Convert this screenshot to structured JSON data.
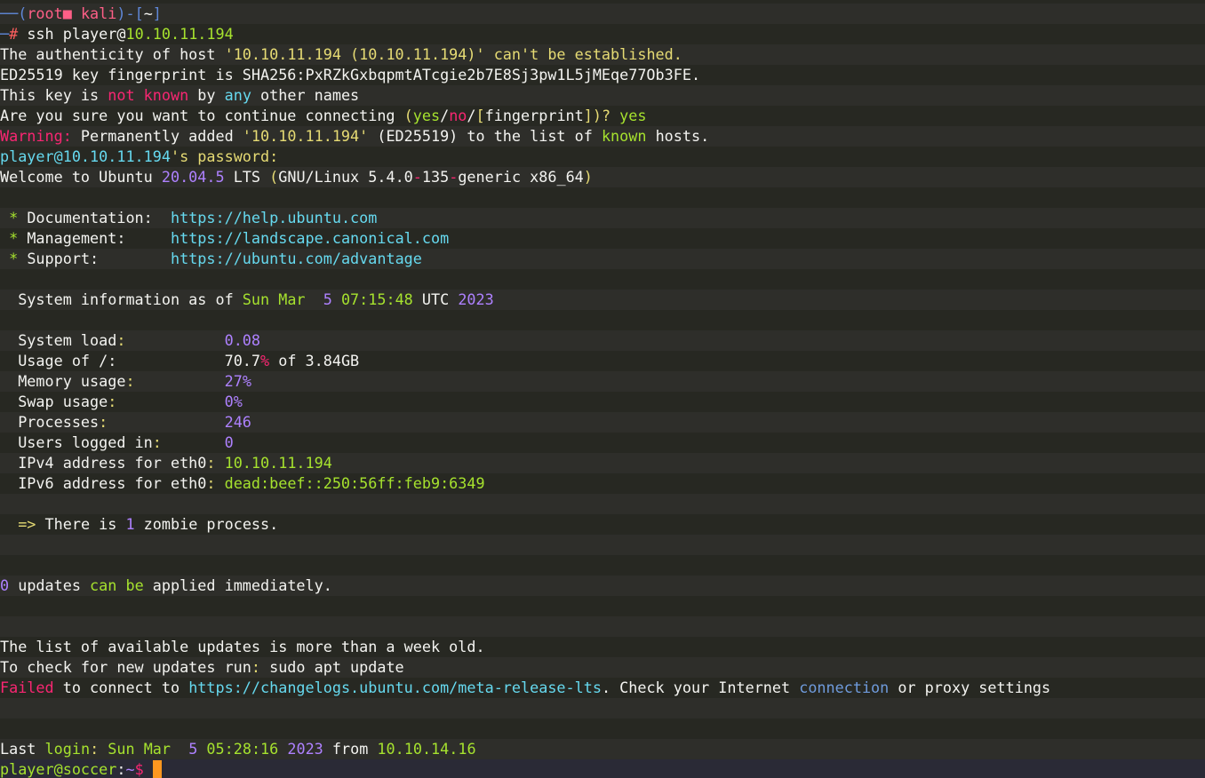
{
  "lines": {
    "l1": {
      "a": "──(",
      "b": "root",
      "c": "■ ",
      "d": "kali",
      "e": ")-[",
      "f": "~",
      "g": "]"
    },
    "l2": {
      "a": "─",
      "b": "# ",
      "c": "ssh ",
      "d": "player@",
      "e": "10.10.11.194"
    },
    "l3": {
      "a": "The authenticity of host ",
      "b": "'10.10.11.194 (10.10.11.194)'",
      "c": " can't be established."
    },
    "l4": {
      "a": "ED25519 key fingerprint is SHA256",
      "b": ":",
      "c": "PxRZkGxbqpmtATcgie2b7E8Sj3pw1L5jMEqe77Ob3FE."
    },
    "l5": {
      "a": "This key is ",
      "b": "not known",
      "c": " by ",
      "d": "any",
      "e": " other names"
    },
    "l6": {
      "a": "Are you sure you want to continue connecting ",
      "b": "(",
      "c": "yes",
      "d": "/",
      "e": "no",
      "f": "/",
      "g": "[",
      "h": "fingerprint",
      "i": "])?",
      "j": " yes"
    },
    "l7": {
      "a": "Warning:",
      "b": " Permanently added ",
      "c": "'10.10.11.194'",
      "d": " (ED25519) to the list of ",
      "e": "known",
      "f": " hosts."
    },
    "l8": {
      "a": "player@10.10.11.194",
      "b": "'s password:"
    },
    "l9": {
      "a": "Welcome to Ubuntu ",
      "b": "20.04.5",
      "c": " LTS ",
      "d": "(",
      "e": "GNU/Linux 5.4.0",
      "f": "-",
      "g": "135",
      "h": "-",
      "i": "generic x86_64",
      "j": ")"
    },
    "l11": {
      "a": " *",
      "b": " Documentation:  ",
      "c": "https://help.ubuntu.com"
    },
    "l12": {
      "a": " *",
      "b": " Management:     ",
      "c": "https://landscape.canonical.com"
    },
    "l13": {
      "a": " *",
      "b": " Support:        ",
      "c": "https://ubuntu.com/advantage"
    },
    "l15": {
      "a": "  System information as of ",
      "b": "Sun Mar  ",
      "c": "5",
      "d": " 07:15:48",
      "e": " UTC ",
      "f": "2023"
    },
    "l17": {
      "a": "  System load",
      "b": ":",
      "c": "           ",
      "d": "0.08"
    },
    "l18": {
      "a": "  Usage of /:            ",
      "b": "70.7",
      "c": "%",
      "d": " of 3.84GB"
    },
    "l19": {
      "a": "  Memory usage",
      "b": ":",
      "c": "          ",
      "d": "27%"
    },
    "l20": {
      "a": "  Swap usage",
      "b": ":",
      "c": "            ",
      "d": "0%"
    },
    "l21": {
      "a": "  Processes",
      "b": ":",
      "c": "             ",
      "d": "246"
    },
    "l22": {
      "a": "  Users logged in",
      "b": ":",
      "c": "       ",
      "d": "0"
    },
    "l23": {
      "a": "  IPv4 address for eth0",
      "b": ": ",
      "c": "10.10.11.194"
    },
    "l24": {
      "a": "  IPv6 address for eth0",
      "b": ": ",
      "c": "dead:beef::250:56ff:feb9:6349"
    },
    "l26": {
      "a": "  =>",
      "b": " There is ",
      "c": "1",
      "d": " zombie process."
    },
    "l29": {
      "a": "0",
      "b": " updates ",
      "c": "can be",
      "d": " applied immediately."
    },
    "l32": {
      "a": "The list of available updates is more than a week old."
    },
    "l33": {
      "a": "To check for new updates run",
      "b": ":",
      "c": " sudo apt update"
    },
    "l34": {
      "a": "Failed",
      "b": " to connect to ",
      "c": "https://changelogs.ubuntu.com/meta-release-lts",
      "d": ". Check your Internet ",
      "e": "connection",
      "f": " or proxy settings"
    },
    "l37": {
      "a": "Last ",
      "b": "login",
      "c": ": ",
      "d": "Sun Mar  ",
      "e": "5",
      "f": " 05:28:16",
      "g": " 2023",
      "h": " from ",
      "i": "10.10.14.16"
    },
    "l38": {
      "a": "player@soccer",
      "b": ":",
      "c": "~",
      "d": "$ "
    }
  },
  "colors": {
    "background": "#272822",
    "alt_row": "#2e2e2a",
    "cursor": "#fd971f"
  }
}
